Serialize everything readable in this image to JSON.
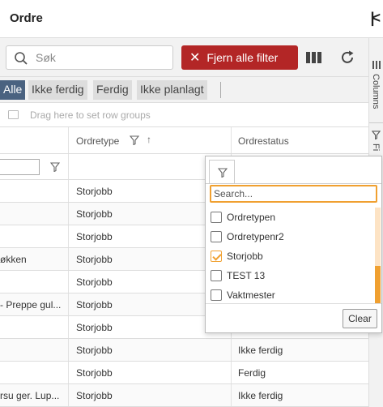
{
  "header": {
    "title": "Ordre",
    "collapse_icon": "collapse-left-icon"
  },
  "toolbar": {
    "search_placeholder": "Søk",
    "clear_filters_label": "Fjern alle  filter",
    "clear_filters_color": "#b32626"
  },
  "tabs": [
    {
      "label": "Alle",
      "active": true
    },
    {
      "label": "Ikke ferdig",
      "active": false
    },
    {
      "label": "Ferdig",
      "active": false
    },
    {
      "label": "Ikke planlagt",
      "active": false
    }
  ],
  "group_zone": {
    "text": "Drag here to set row groups"
  },
  "columns": [
    {
      "label": "Ordretype",
      "sort": "ascending"
    },
    {
      "label": "Ordrestatus"
    }
  ],
  "rows": [
    {
      "c0": "",
      "c1": "Storjobb",
      "c2": ""
    },
    {
      "c0": "",
      "c1": "Storjobb",
      "c2": ""
    },
    {
      "c0": "",
      "c1": "Storjobb",
      "c2": ""
    },
    {
      "c0": "økken",
      "c1": "Storjobb",
      "c2": ""
    },
    {
      "c0": "",
      "c1": "Storjobb",
      "c2": ""
    },
    {
      "c0": "- Preppe gul...",
      "c1": "Storjobb",
      "c2": ""
    },
    {
      "c0": "",
      "c1": "Storjobb",
      "c2": ""
    },
    {
      "c0": "",
      "c1": "Storjobb",
      "c2": "Ikke ferdig"
    },
    {
      "c0": "",
      "c1": "Storjobb",
      "c2": "Ferdig"
    },
    {
      "c0": "rsu ger. Lup...",
      "c1": "Storjobb",
      "c2": "Ikke ferdig"
    }
  ],
  "side_panel": {
    "columns_label": "Columns",
    "filters_label": "Fi"
  },
  "filter_popup": {
    "search_placeholder": "Search...",
    "options": [
      {
        "label": "Ordretypen",
        "checked": false
      },
      {
        "label": "Ordretypenr2",
        "checked": false
      },
      {
        "label": "Storjobb",
        "checked": true
      },
      {
        "label": "TEST 13",
        "checked": false
      },
      {
        "label": "Vaktmester",
        "checked": false
      }
    ],
    "clear_label": "Clear",
    "accent_color": "#f0a030"
  }
}
